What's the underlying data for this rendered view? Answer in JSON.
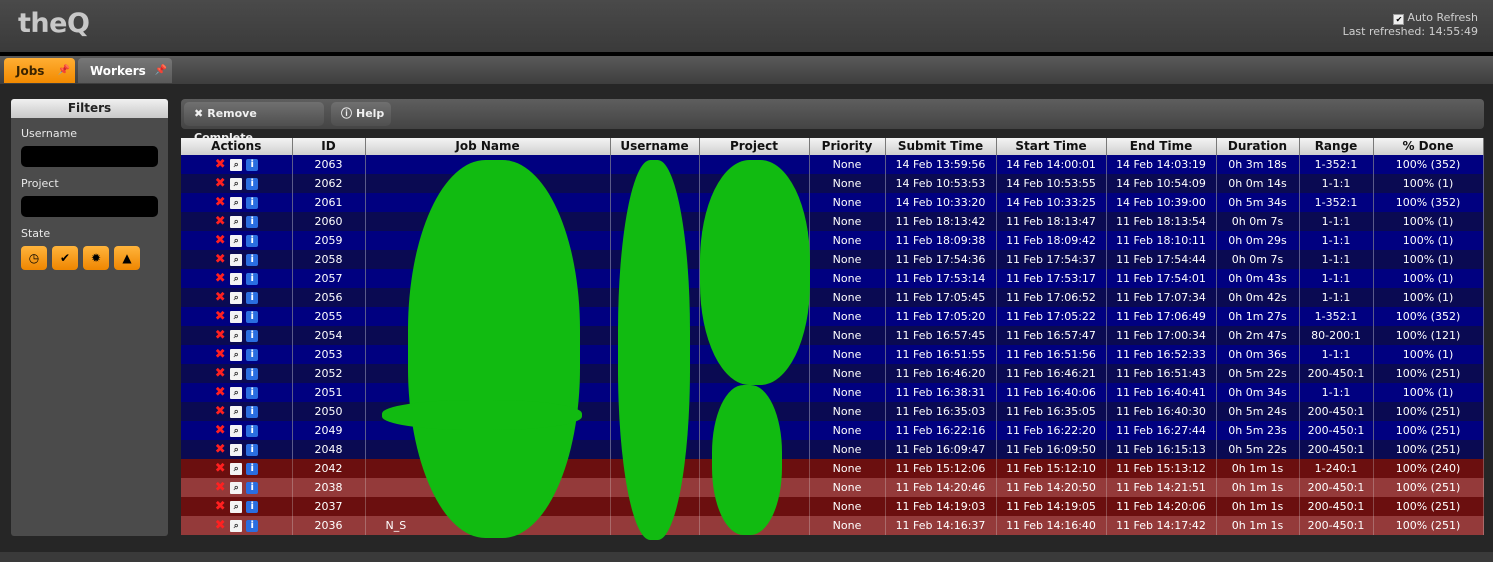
{
  "app": {
    "title": "theQ"
  },
  "refresh": {
    "auto_label": "Auto Refresh",
    "last_refreshed": "Last refreshed: 14:55:49"
  },
  "tabs": [
    {
      "label": "Jobs"
    },
    {
      "label": "Workers"
    }
  ],
  "filters": {
    "title": "Filters",
    "username_label": "Username",
    "project_label": "Project",
    "state_label": "State",
    "state_icons": [
      "clock-icon",
      "check-icon",
      "gear-icon",
      "warning-icon"
    ]
  },
  "toolbar": {
    "remove_label": "Remove Complete",
    "help_label": "Help"
  },
  "table": {
    "columns": [
      "Actions",
      "ID",
      "Job Name",
      "Username",
      "Project",
      "Priority",
      "Submit Time",
      "Start Time",
      "End Time",
      "Duration",
      "Range",
      "% Done"
    ],
    "rows": [
      {
        "id": "2063",
        "job": "",
        "priority": "None",
        "submit": "14 Feb 13:59:56",
        "start": "14 Feb 14:00:01",
        "end": "14 Feb 14:03:19",
        "duration": "0h 3m 18s",
        "range": "1-352:1",
        "done": "100% (352)",
        "status": "blue"
      },
      {
        "id": "2062",
        "job": "",
        "priority": "None",
        "submit": "14 Feb 10:53:53",
        "start": "14 Feb 10:53:55",
        "end": "14 Feb 10:54:09",
        "duration": "0h 0m 14s",
        "range": "1-1:1",
        "done": "100% (1)",
        "status": "blue"
      },
      {
        "id": "2061",
        "job": "",
        "priority": "None",
        "submit": "14 Feb 10:33:20",
        "start": "14 Feb 10:33:25",
        "end": "14 Feb 10:39:00",
        "duration": "0h 5m 34s",
        "range": "1-352:1",
        "done": "100% (352)",
        "status": "blue"
      },
      {
        "id": "2060",
        "job": "",
        "priority": "None",
        "submit": "11 Feb 18:13:42",
        "start": "11 Feb 18:13:47",
        "end": "11 Feb 18:13:54",
        "duration": "0h 0m 7s",
        "range": "1-1:1",
        "done": "100% (1)",
        "status": "blue"
      },
      {
        "id": "2059",
        "job": "",
        "priority": "None",
        "submit": "11 Feb 18:09:38",
        "start": "11 Feb 18:09:42",
        "end": "11 Feb 18:10:11",
        "duration": "0h 0m 29s",
        "range": "1-1:1",
        "done": "100% (1)",
        "status": "blue"
      },
      {
        "id": "2058",
        "job": "",
        "priority": "None",
        "submit": "11 Feb 17:54:36",
        "start": "11 Feb 17:54:37",
        "end": "11 Feb 17:54:44",
        "duration": "0h 0m 7s",
        "range": "1-1:1",
        "done": "100% (1)",
        "status": "blue"
      },
      {
        "id": "2057",
        "job": "",
        "priority": "None",
        "submit": "11 Feb 17:53:14",
        "start": "11 Feb 17:53:17",
        "end": "11 Feb 17:54:01",
        "duration": "0h 0m 43s",
        "range": "1-1:1",
        "done": "100% (1)",
        "status": "blue"
      },
      {
        "id": "2056",
        "job": "",
        "priority": "None",
        "submit": "11 Feb 17:05:45",
        "start": "11 Feb 17:06:52",
        "end": "11 Feb 17:07:34",
        "duration": "0h 0m 42s",
        "range": "1-1:1",
        "done": "100% (1)",
        "status": "blue"
      },
      {
        "id": "2055",
        "job": "",
        "priority": "None",
        "submit": "11 Feb 17:05:20",
        "start": "11 Feb 17:05:22",
        "end": "11 Feb 17:06:49",
        "duration": "0h 1m 27s",
        "range": "1-352:1",
        "done": "100% (352)",
        "status": "blue"
      },
      {
        "id": "2054",
        "job": "",
        "priority": "None",
        "submit": "11 Feb 16:57:45",
        "start": "11 Feb 16:57:47",
        "end": "11 Feb 17:00:34",
        "duration": "0h 2m 47s",
        "range": "80-200:1",
        "done": "100% (121)",
        "status": "blue"
      },
      {
        "id": "2053",
        "job": "",
        "priority": "None",
        "submit": "11 Feb 16:51:55",
        "start": "11 Feb 16:51:56",
        "end": "11 Feb 16:52:33",
        "duration": "0h 0m 36s",
        "range": "1-1:1",
        "done": "100% (1)",
        "status": "blue"
      },
      {
        "id": "2052",
        "job": "",
        "priority": "None",
        "submit": "11 Feb 16:46:20",
        "start": "11 Feb 16:46:21",
        "end": "11 Feb 16:51:43",
        "duration": "0h 5m 22s",
        "range": "200-450:1",
        "done": "100% (251)",
        "status": "blue"
      },
      {
        "id": "2051",
        "job": "",
        "priority": "None",
        "submit": "11 Feb 16:38:31",
        "start": "11 Feb 16:40:06",
        "end": "11 Feb 16:40:41",
        "duration": "0h 0m 34s",
        "range": "1-1:1",
        "done": "100% (1)",
        "status": "blue"
      },
      {
        "id": "2050",
        "job": "",
        "priority": "None",
        "submit": "11 Feb 16:35:03",
        "start": "11 Feb 16:35:05",
        "end": "11 Feb 16:40:30",
        "duration": "0h 5m 24s",
        "range": "200-450:1",
        "done": "100% (251)",
        "status": "blue"
      },
      {
        "id": "2049",
        "job": "",
        "priority": "None",
        "submit": "11 Feb 16:22:16",
        "start": "11 Feb 16:22:20",
        "end": "11 Feb 16:27:44",
        "duration": "0h 5m 23s",
        "range": "200-450:1",
        "done": "100% (251)",
        "status": "blue"
      },
      {
        "id": "2048",
        "job": "",
        "priority": "None",
        "submit": "11 Feb 16:09:47",
        "start": "11 Feb 16:09:50",
        "end": "11 Feb 16:15:13",
        "duration": "0h 5m 22s",
        "range": "200-450:1",
        "done": "100% (251)",
        "status": "blue"
      },
      {
        "id": "2042",
        "job": "",
        "priority": "None",
        "submit": "11 Feb 15:12:06",
        "start": "11 Feb 15:12:10",
        "end": "11 Feb 15:13:12",
        "duration": "0h 1m 1s",
        "range": "1-240:1",
        "done": "100% (240)",
        "status": "red"
      },
      {
        "id": "2038",
        "job": "",
        "priority": "None",
        "submit": "11 Feb 14:20:46",
        "start": "11 Feb 14:20:50",
        "end": "11 Feb 14:21:51",
        "duration": "0h 1m 1s",
        "range": "200-450:1",
        "done": "100% (251)",
        "status": "red"
      },
      {
        "id": "2037",
        "job": "",
        "priority": "None",
        "submit": "11 Feb 14:19:03",
        "start": "11 Feb 14:19:05",
        "end": "11 Feb 14:20:06",
        "duration": "0h 1m 1s",
        "range": "200-450:1",
        "done": "100% (251)",
        "status": "red"
      },
      {
        "id": "2036",
        "job": "N_S",
        "priority": "None",
        "submit": "11 Feb 14:16:37",
        "start": "11 Feb 14:16:40",
        "end": "11 Feb 14:17:42",
        "duration": "0h 1m 1s",
        "range": "200-450:1",
        "done": "100% (251)",
        "status": "red"
      }
    ]
  }
}
